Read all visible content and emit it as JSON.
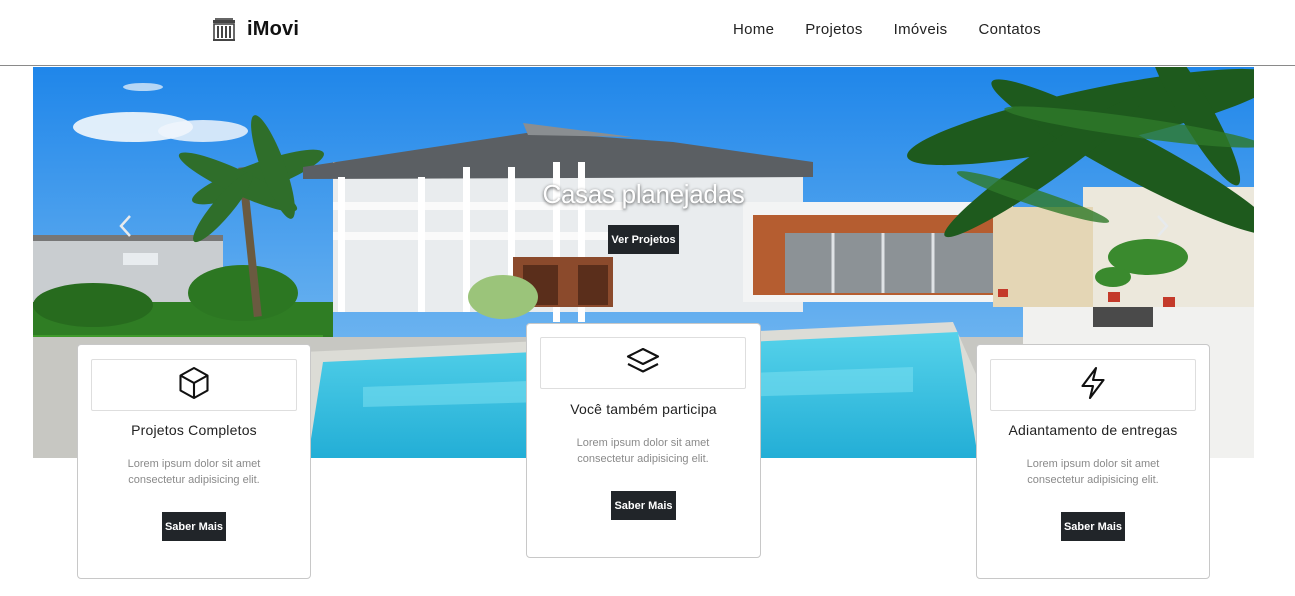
{
  "brand": {
    "name": "iMovi",
    "icon": "building-icon"
  },
  "nav": {
    "items": [
      "Home",
      "Projetos",
      "Imóveis",
      "Contatos"
    ]
  },
  "hero": {
    "caption": "Casas planejadas",
    "button_label": "Ver Projetos",
    "prev_icon": "chevron-left-icon",
    "next_icon": "chevron-right-icon"
  },
  "cards": [
    {
      "icon": "box-icon",
      "title": "Projetos Completos",
      "text": "Lorem ipsum dolor sit amet consectetur adipisicing elit.",
      "button_label": "Saber Mais"
    },
    {
      "icon": "layers-icon",
      "title": "Você também participa",
      "text": "Lorem ipsum dolor sit amet consectetur adipisicing elit.",
      "button_label": "Saber Mais"
    },
    {
      "icon": "lightning-icon",
      "title": "Adiantamento de entregas",
      "text": "Lorem ipsum dolor sit amet consectetur adipisicing elit.",
      "button_label": "Saber Mais"
    }
  ],
  "colors": {
    "dark_button": "#212529",
    "pool": "#36c3e0",
    "sky": "#2f8fe6"
  }
}
